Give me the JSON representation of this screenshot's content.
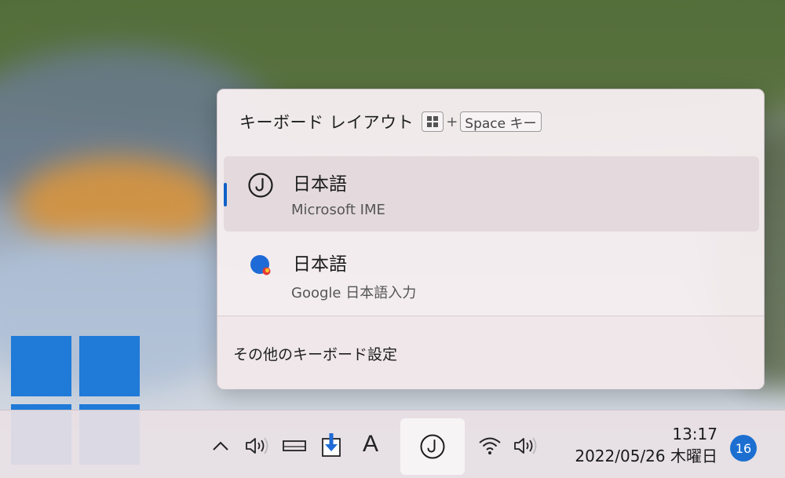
{
  "flyout": {
    "title": "キーボード レイアウト",
    "shortcut_plus": "+",
    "shortcut_key": "Space キー",
    "layouts": [
      {
        "name": "日本語",
        "ime": "Microsoft IME",
        "icon": "microsoft-ime-icon",
        "selected": true
      },
      {
        "name": "日本語",
        "ime": "Google 日本語入力",
        "icon": "google-ime-icon",
        "selected": false
      }
    ],
    "settings_link": "その他のキーボード設定"
  },
  "taskbar": {
    "ime_mode": "A",
    "time": "13:17",
    "date": "2022/05/26 木曜日",
    "notification_count": "16"
  },
  "colors": {
    "accent": "#1060c8",
    "windows_logo": "#1f7ad8",
    "notification_badge": "#1c6fd1"
  }
}
